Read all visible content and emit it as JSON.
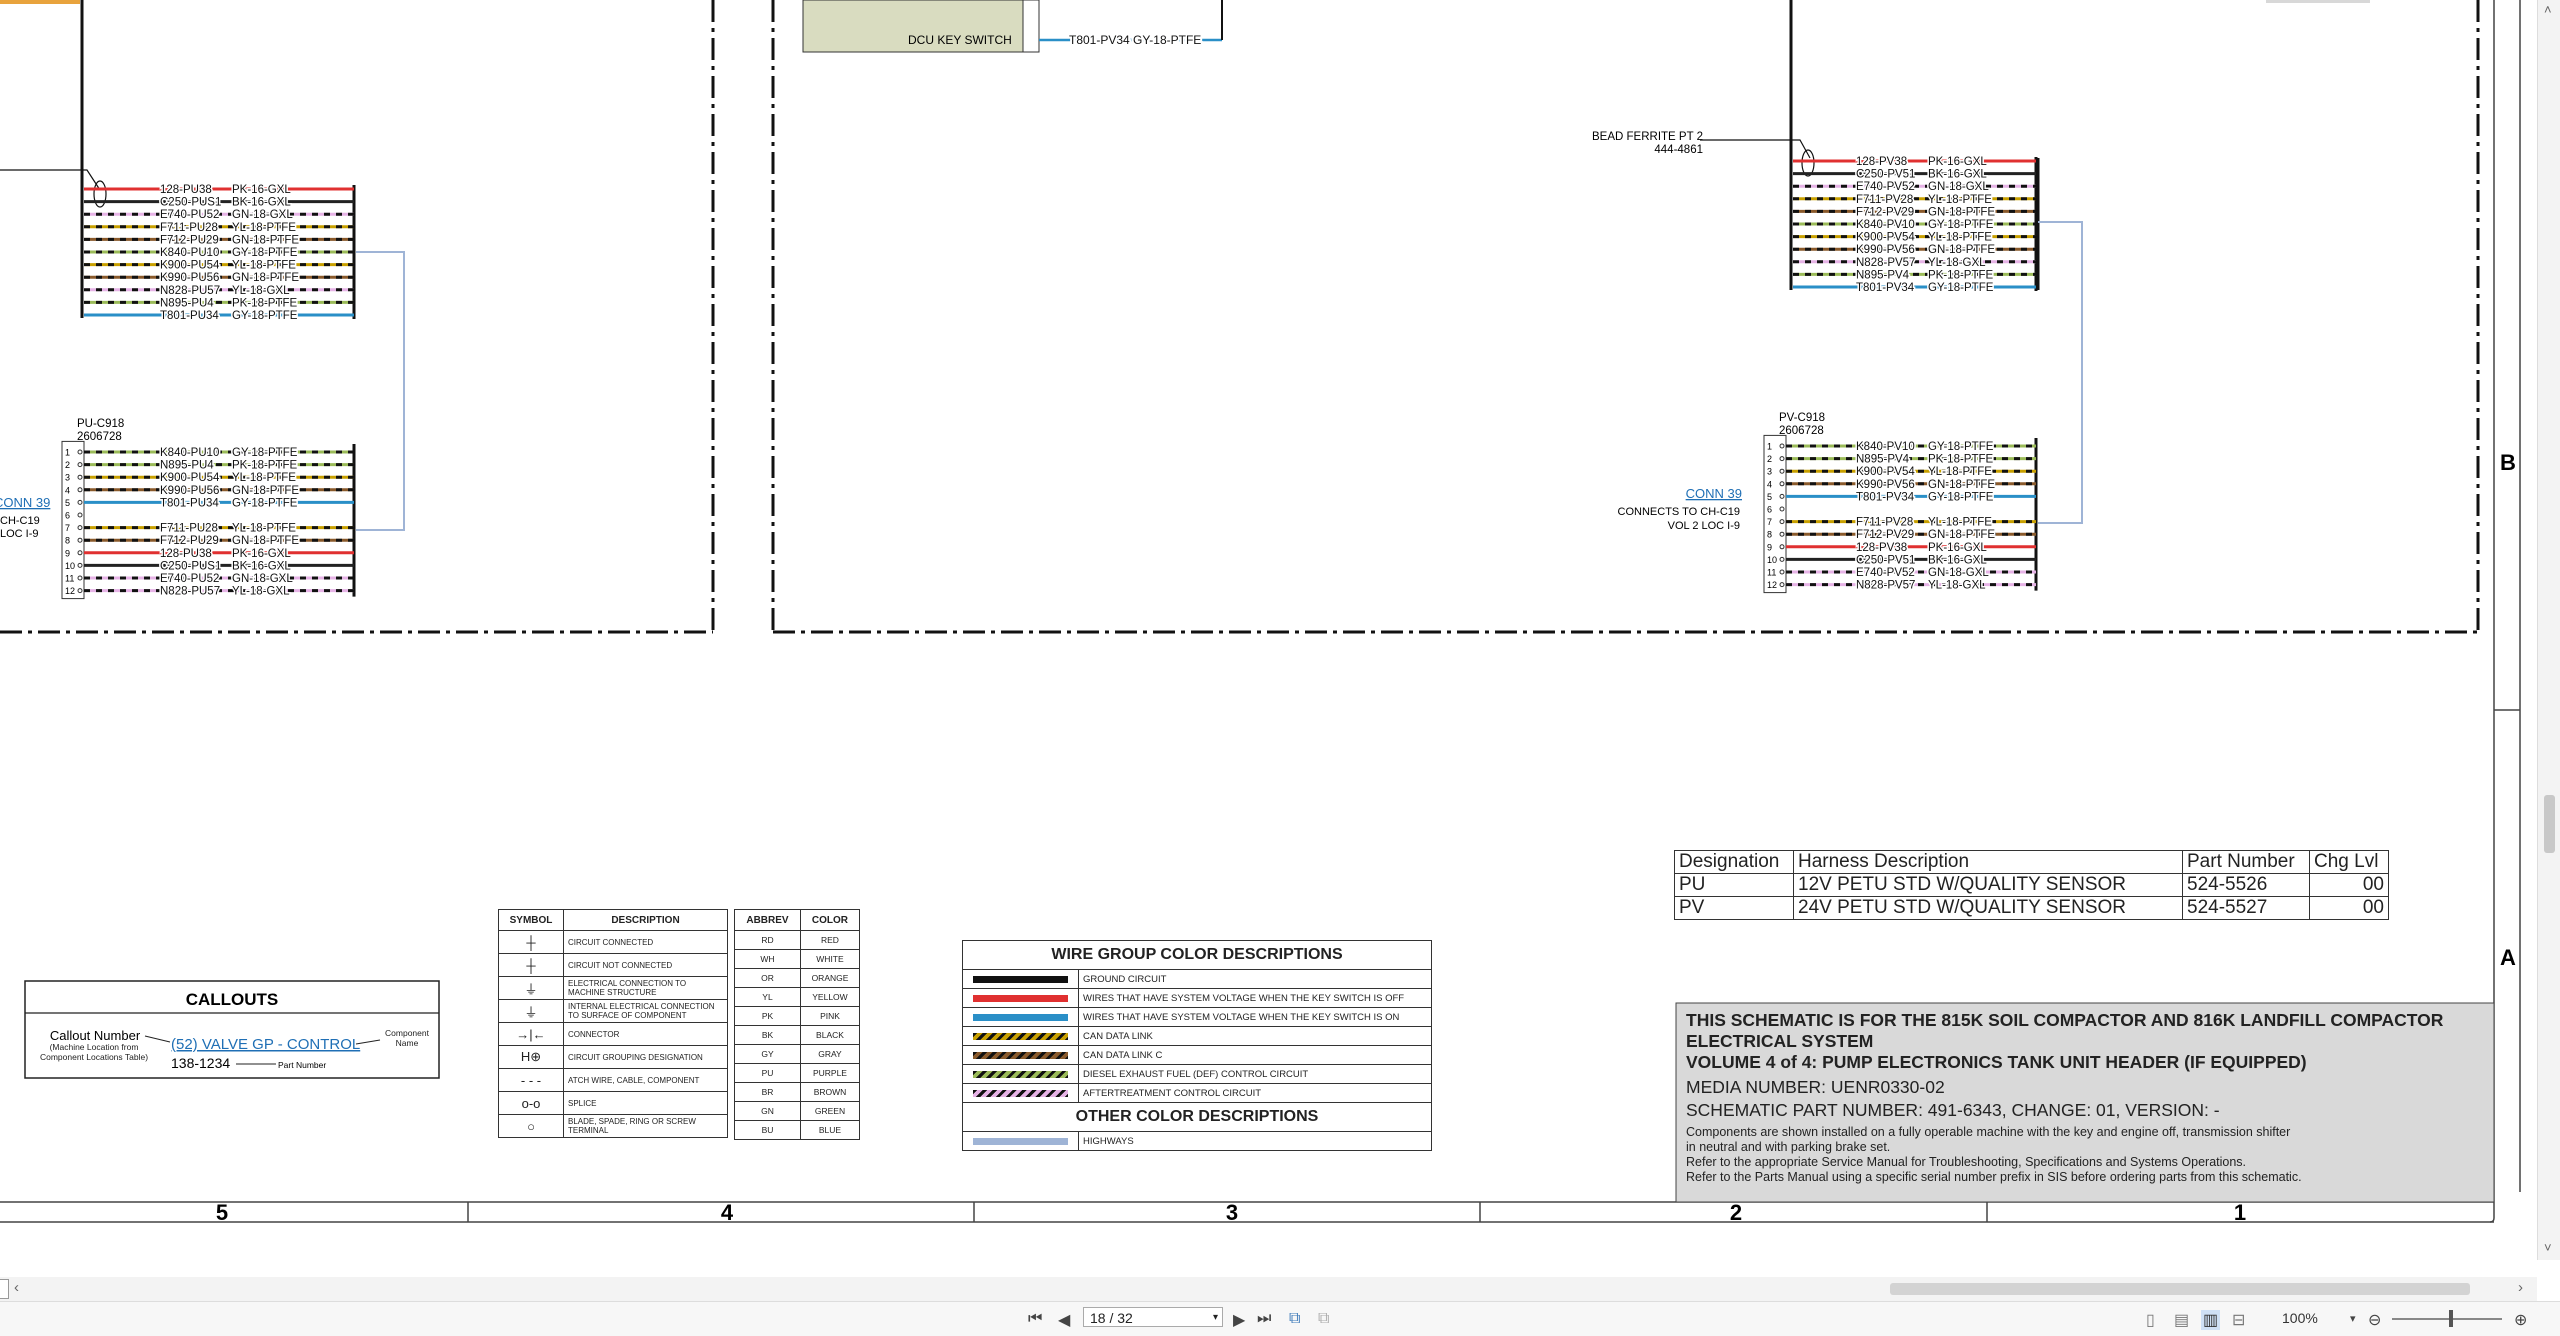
{
  "drawing": {
    "dcu_key_switch": "DCU KEY SWITCH",
    "dcu_wire": "T801-PV34   GY-18-PTFE",
    "left_bundle": [
      {
        "circuit": "128-PU38",
        "wire": "PK-16-GXL",
        "color": "#e03030"
      },
      {
        "circuit": "C250-PUS1",
        "wire": "BK-16-GXL",
        "color": "#222222"
      },
      {
        "circuit": "E740-PU52",
        "wire": "GN-18-GXL",
        "color": "#e6b3e6"
      },
      {
        "circuit": "F711-PU28",
        "wire": "YL-18-PTFE",
        "color": "#c8a000"
      },
      {
        "circuit": "F712-PU29",
        "wire": "GN-18-PTFE",
        "color": "#8a5a2b"
      },
      {
        "circuit": "K840-PU10",
        "wire": "GY-18-PTFE",
        "color": "#9bbb59"
      },
      {
        "circuit": "K900-PU54",
        "wire": "YL-18-PTFE",
        "color": "#c8a000"
      },
      {
        "circuit": "K990-PU56",
        "wire": "GN-18-PTFE",
        "color": "#8a5a2b"
      },
      {
        "circuit": "N828-PU57",
        "wire": "YL-18-GXL",
        "color": "#e6b3e6"
      },
      {
        "circuit": "N895-PU4",
        "wire": "PK-18-PTFE",
        "color": "#9bbb59"
      },
      {
        "circuit": "T801-PU34",
        "wire": "GY-18-PTFE",
        "color": "#2a8fc7"
      }
    ],
    "left_conn": {
      "name": "PU-C918",
      "part": "2606728",
      "conn_link": "CONN 39",
      "connects_to": "CH-C19",
      "loc": "LOC I-9",
      "pins": [
        {
          "pin": "1",
          "circuit": "K840-PU10",
          "wire": "GY-18-PTFE",
          "color": "#9bbb59"
        },
        {
          "pin": "2",
          "circuit": "N895-PU4",
          "wire": "PK-18-PTFE",
          "color": "#9bbb59"
        },
        {
          "pin": "3",
          "circuit": "K900-PU54",
          "wire": "YL-18-PTFE",
          "color": "#c8a000"
        },
        {
          "pin": "4",
          "circuit": "K990-PU56",
          "wire": "GN-18-PTFE",
          "color": "#8a5a2b"
        },
        {
          "pin": "5",
          "circuit": "T801-PU34",
          "wire": "GY-18-PTFE",
          "color": "#2a8fc7"
        },
        {
          "pin": "6",
          "circuit": "",
          "wire": "",
          "color": ""
        },
        {
          "pin": "7",
          "circuit": "F711-PU28",
          "wire": "YL-18-PTFE",
          "color": "#c8a000"
        },
        {
          "pin": "8",
          "circuit": "F712-PU29",
          "wire": "GN-18-PTFE",
          "color": "#8a5a2b"
        },
        {
          "pin": "9",
          "circuit": "128-PU38",
          "wire": "PK-16-GXL",
          "color": "#e03030"
        },
        {
          "pin": "10",
          "circuit": "C250-PUS1",
          "wire": "BK-16-GXL",
          "color": "#222222"
        },
        {
          "pin": "11",
          "circuit": "E740-PU52",
          "wire": "GN-18-GXL",
          "color": "#e6b3e6"
        },
        {
          "pin": "12",
          "circuit": "N828-PU57",
          "wire": "YL-18-GXL",
          "color": "#e6b3e6"
        }
      ]
    },
    "right_ferrite": {
      "label": "BEAD FERRITE PT 2",
      "part": "444-4861"
    },
    "right_bundle": [
      {
        "circuit": "128-PV38",
        "wire": "PK-16-GXL",
        "color": "#e03030"
      },
      {
        "circuit": "C250-PV51",
        "wire": "BK-16-GXL",
        "color": "#222222"
      },
      {
        "circuit": "E740-PV52",
        "wire": "GN-18-GXL",
        "color": "#e6b3e6"
      },
      {
        "circuit": "F711-PV28",
        "wire": "YL-18-PTFE",
        "color": "#c8a000"
      },
      {
        "circuit": "F712-PV29",
        "wire": "GN-18-PTFE",
        "color": "#8a5a2b"
      },
      {
        "circuit": "K840-PV10",
        "wire": "GY-18-PTFE",
        "color": "#9bbb59"
      },
      {
        "circuit": "K900-PV54",
        "wire": "YL-18-PTFE",
        "color": "#c8a000"
      },
      {
        "circuit": "K990-PV56",
        "wire": "GN-18-PTFE",
        "color": "#8a5a2b"
      },
      {
        "circuit": "N828-PV57",
        "wire": "YL-18-GXL",
        "color": "#e6b3e6"
      },
      {
        "circuit": "N895-PV4",
        "wire": "PK-18-PTFE",
        "color": "#9bbb59"
      },
      {
        "circuit": "T801-PV34",
        "wire": "GY-18-PTFE",
        "color": "#2a8fc7"
      }
    ],
    "right_conn": {
      "name": "PV-C918",
      "part": "2606728",
      "conn_link": "CONN 39",
      "connects_to": "CONNECTS TO CH-C19",
      "loc": "VOL 2 LOC I-9",
      "pins": [
        {
          "pin": "1",
          "circuit": "K840-PV10",
          "wire": "GY-18-PTFE",
          "color": "#9bbb59"
        },
        {
          "pin": "2",
          "circuit": "N895-PV4",
          "wire": "PK-18-PTFE",
          "color": "#9bbb59"
        },
        {
          "pin": "3",
          "circuit": "K900-PV54",
          "wire": "YL-18-PTFE",
          "color": "#c8a000"
        },
        {
          "pin": "4",
          "circuit": "K990-PV56",
          "wire": "GN-18-PTFE",
          "color": "#8a5a2b"
        },
        {
          "pin": "5",
          "circuit": "T801-PV34",
          "wire": "GY-18-PTFE",
          "color": "#2a8fc7"
        },
        {
          "pin": "6",
          "circuit": "",
          "wire": "",
          "color": ""
        },
        {
          "pin": "7",
          "circuit": "F711-PV28",
          "wire": "YL-18-PTFE",
          "color": "#c8a000"
        },
        {
          "pin": "8",
          "circuit": "F712-PV29",
          "wire": "GN-18-PTFE",
          "color": "#8a5a2b"
        },
        {
          "pin": "9",
          "circuit": "128-PV38",
          "wire": "PK-16-GXL",
          "color": "#e03030"
        },
        {
          "pin": "10",
          "circuit": "C250-PV51",
          "wire": "BK-16-GXL",
          "color": "#222222"
        },
        {
          "pin": "11",
          "circuit": "E740-PV52",
          "wire": "GN-18-GXL",
          "color": "#e6b3e6"
        },
        {
          "pin": "12",
          "circuit": "N828-PV57",
          "wire": "YL-18-GXL",
          "color": "#e6b3e6"
        }
      ]
    },
    "zone_letters": [
      "B",
      "A"
    ],
    "column_numbers": [
      "5",
      "4",
      "3",
      "2",
      "1"
    ]
  },
  "callouts": {
    "title": "CALLOUTS",
    "callout_number": "Callout Number",
    "callout_note": "(Machine Location from Component Locations Table)",
    "sample_link": "(52) VALVE GP - CONTROL",
    "sample_part": "138-1234",
    "component_name": "Component Name",
    "part_number": "Part Number"
  },
  "symbols": {
    "headers": [
      "SYMBOL",
      "DESCRIPTION"
    ],
    "rows": [
      {
        "icon": "circuit-connected",
        "glyph": "┼",
        "desc": "CIRCUIT CONNECTED"
      },
      {
        "icon": "circuit-not-connected",
        "glyph": "┼",
        "desc": "CIRCUIT NOT CONNECTED"
      },
      {
        "icon": "machine-ground",
        "glyph": "⏚",
        "desc": "ELECTRICAL CONNECTION TO MACHINE STRUCTURE"
      },
      {
        "icon": "internal-ground",
        "glyph": "⏚",
        "desc": "INTERNAL ELECTRICAL CONNECTION TO SURFACE OF COMPONENT"
      },
      {
        "icon": "connector",
        "glyph": "→|←",
        "desc": "CONNECTOR"
      },
      {
        "icon": "grouping",
        "glyph": "H⊕",
        "desc": "CIRCUIT GROUPING DESIGNATION"
      },
      {
        "icon": "attach-wire",
        "glyph": "- - -",
        "desc": "ATCH WIRE, CABLE, COMPONENT"
      },
      {
        "icon": "splice",
        "glyph": "o-o",
        "desc": "SPLICE"
      },
      {
        "icon": "terminal",
        "glyph": "○",
        "desc": "BLADE, SPADE, RING OR SCREW TERMINAL"
      }
    ]
  },
  "abbrev": {
    "headers": [
      "ABBREV",
      "COLOR"
    ],
    "rows": [
      [
        "RD",
        "RED"
      ],
      [
        "WH",
        "WHITE"
      ],
      [
        "OR",
        "ORANGE"
      ],
      [
        "YL",
        "YELLOW"
      ],
      [
        "PK",
        "PINK"
      ],
      [
        "BK",
        "BLACK"
      ],
      [
        "GY",
        "GRAY"
      ],
      [
        "PU",
        "PURPLE"
      ],
      [
        "BR",
        "BROWN"
      ],
      [
        "GN",
        "GREEN"
      ],
      [
        "BU",
        "BLUE"
      ]
    ]
  },
  "wire_groups": {
    "title": "WIRE GROUP COLOR DESCRIPTIONS",
    "rows": [
      {
        "swatch": "#111111",
        "pattern": "solid",
        "desc": "GROUND CIRCUIT"
      },
      {
        "swatch": "#e03030",
        "pattern": "solid",
        "desc": "WIRES THAT HAVE SYSTEM VOLTAGE WHEN THE KEY SWITCH IS OFF"
      },
      {
        "swatch": "#2a8fc7",
        "pattern": "solid",
        "desc": "WIRES THAT HAVE SYSTEM VOLTAGE WHEN THE KEY SWITCH IS ON"
      },
      {
        "swatch": "#c8a000",
        "pattern": "hatch",
        "desc": "CAN DATA LINK"
      },
      {
        "swatch": "#8a5a2b",
        "pattern": "hatch",
        "desc": "CAN DATA LINK C"
      },
      {
        "swatch": "#9bbb59",
        "pattern": "hatch",
        "desc": "DIESEL EXHAUST FUEL (DEF) CONTROL CIRCUIT"
      },
      {
        "swatch": "#e6b3e6",
        "pattern": "hatch",
        "desc": "AFTERTREATMENT CONTROL CIRCUIT"
      }
    ],
    "other_title": "OTHER COLOR DESCRIPTIONS",
    "other_rows": [
      {
        "swatch": "#9fb4d6",
        "pattern": "solid",
        "desc": "HIGHWAYS"
      }
    ]
  },
  "harness": {
    "headers": [
      "Designation",
      "Harness Description",
      "Part Number",
      "Chg Lvl"
    ],
    "rows": [
      [
        "PU",
        "12V PETU STD W/QUALITY SENSOR",
        "524-5526",
        "00"
      ],
      [
        "PV",
        "24V PETU STD W/QUALITY SENSOR",
        "524-5527",
        "00"
      ]
    ]
  },
  "titleblock": {
    "line1": "THIS SCHEMATIC IS FOR THE 815K SOIL COMPACTOR AND 816K LANDFILL COMPACTOR",
    "line2": "ELECTRICAL SYSTEM",
    "line3": "VOLUME 4 of 4: PUMP ELECTRONICS TANK UNIT HEADER (IF EQUIPPED)",
    "media": "MEDIA NUMBER: UENR0330-02",
    "part": "SCHEMATIC PART NUMBER: 491-6343, CHANGE: 01, VERSION: -",
    "note1": "Components are shown installed on a fully operable machine with the key and engine off, transmission shifter",
    "note2": "in neutral and with parking brake set.",
    "note3": "Refer to the appropriate Service Manual for Troubleshooting, Specifications and Systems Operations.",
    "note4": "Refer to the Parts Manual using a specific serial number prefix in SIS before ordering parts from this schematic."
  },
  "statusbar": {
    "page_value": "18 / 32",
    "zoom": "100%"
  }
}
